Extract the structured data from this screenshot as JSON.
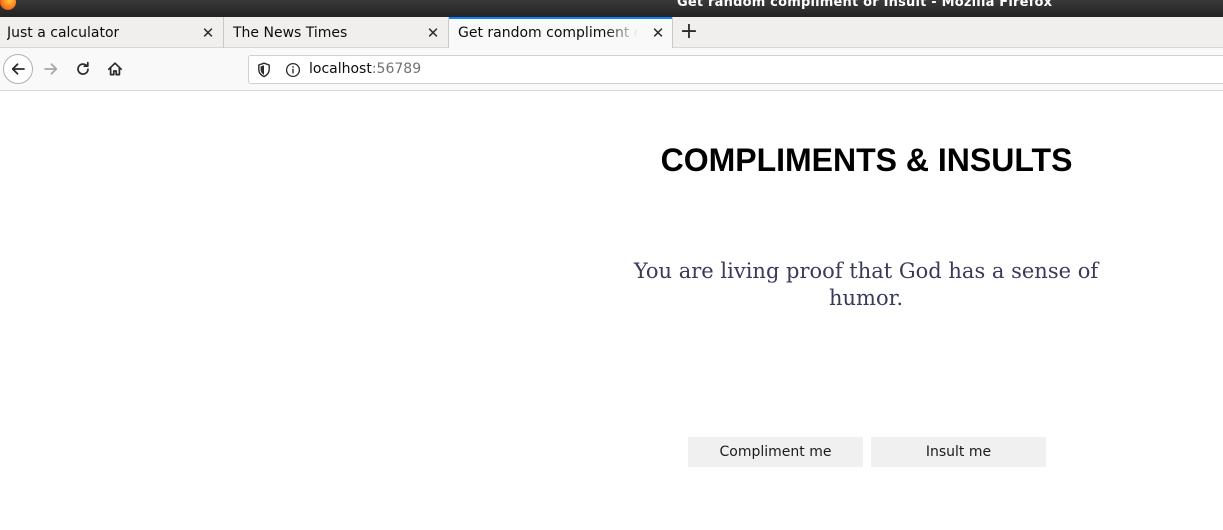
{
  "window": {
    "title": "Get random compliment or Insult - Mozilla Firefox"
  },
  "tabs": [
    {
      "label": "Just a calculator",
      "active": false
    },
    {
      "label": "The News Times",
      "active": false
    },
    {
      "label": "Get random compliment or Insult",
      "active": true
    }
  ],
  "icons": {
    "tab_close": "close-icon",
    "new_tab": "plus-icon",
    "back": "back-arrow-icon",
    "forward": "forward-arrow-icon",
    "reload": "reload-icon",
    "home": "home-icon",
    "tracking": "shield-icon",
    "site_info": "info-icon"
  },
  "urlbar": {
    "host": "localhost",
    "port": ":56789"
  },
  "page": {
    "heading": "COMPLIMENTS & INSULTS",
    "message": "You are living proof that God has a sense of humor.",
    "compliment_button": "Compliment me",
    "insult_button": "Insult me"
  },
  "colors": {
    "active_tab_accent": "#0a84ff",
    "message_text": "#3a3a5a",
    "button_bg": "#f0f0f0"
  }
}
